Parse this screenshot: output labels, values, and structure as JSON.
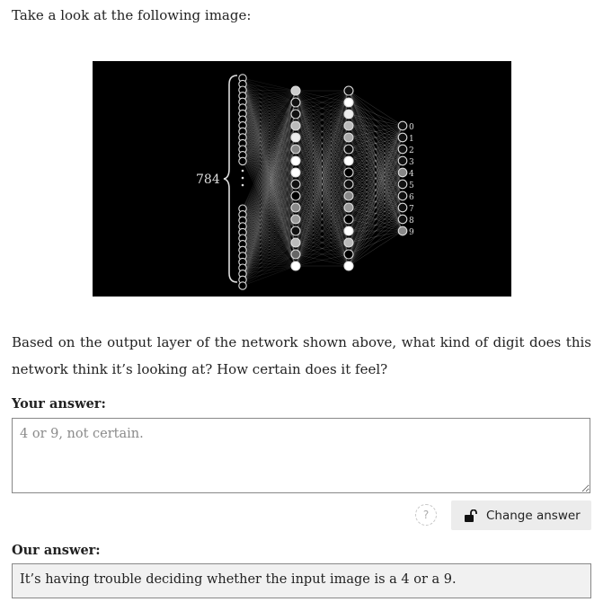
{
  "intro_text": "Take a look at the following image:",
  "figure": {
    "input_count_label": "784",
    "output_digits": [
      "0",
      "1",
      "2",
      "3",
      "4",
      "5",
      "6",
      "7",
      "8",
      "9"
    ]
  },
  "question": "Based on the output layer of the network shown above, what kind of digit does this network think it’s looking at? How certain does it feel?",
  "your_answer": {
    "label": "Your answer:",
    "placeholder": "4 or 9, not certain."
  },
  "help_label": "?",
  "change_button_label": "Change answer",
  "our_answer": {
    "label": "Our answer:",
    "text": "It’s having trouble deciding whether the input image is a 4 or a 9."
  }
}
